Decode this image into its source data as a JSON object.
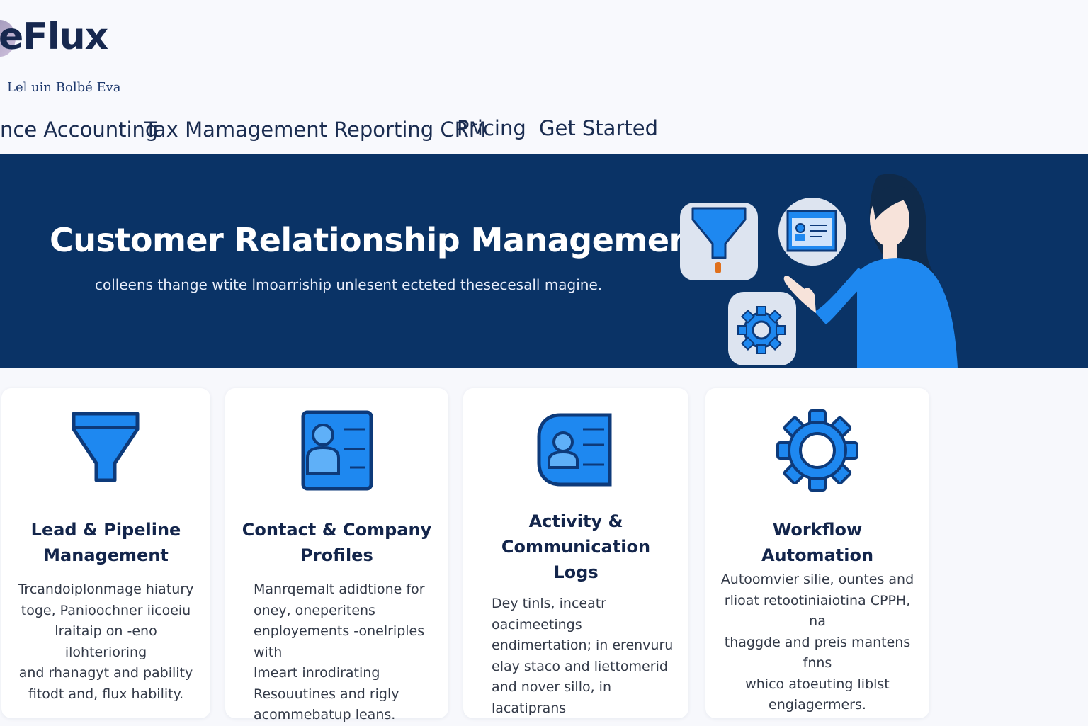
{
  "brand": {
    "logo_text": "eFlux",
    "tagline": "Lel uin Bolbé Eva"
  },
  "nav": {
    "items": [
      {
        "label": "nce Accounting"
      },
      {
        "label": "Tax Mamagement Reporting CRM"
      },
      {
        "label": "Pricing"
      },
      {
        "label": "Get Started"
      }
    ]
  },
  "hero": {
    "title": "Customer Relationship Management",
    "subtitle": "colleens thange wtite lmoarriship unlesent ecteted thesecesall magine."
  },
  "cards": [
    {
      "icon": "funnel-icon",
      "title_lines": [
        "Lead & Pipeline",
        "Management"
      ],
      "body_lines": [
        "Trcandoiplonmage hiatury",
        "toge, Panioochner iicoeiu",
        "lraitaip on -eno ilohterioring",
        "and rhanagyt and pability",
        "fitodt and, flux hability."
      ]
    },
    {
      "icon": "contact-card-icon",
      "title_lines": [
        "Contact & Company",
        "Profiles"
      ],
      "body_lines": [
        "Manrqemalt adidtione for",
        "oney, oneperitens",
        "enployements -onelriples with",
        "lmeart inrodirating",
        "Resouutines and rigly",
        "acommebatup leans."
      ]
    },
    {
      "icon": "activity-log-icon",
      "title_lines": [
        "Activity &",
        "Communication",
        "Logs"
      ],
      "body_lines": [
        "Dey tinls, inceatr oacimeetings",
        "endimertation; in erenvuru",
        "elay staco and liettomerid",
        "and nover sillo, in lacatiprans"
      ]
    },
    {
      "icon": "gear-icon",
      "title_lines": [
        "Workflow Automation"
      ],
      "body_lines": [
        "Autoomvier silie, ountes and",
        "rlioat retootiniaiotina CPPH, na",
        "thaggde and preis mantens fnns",
        "whico atoeuting liblst",
        "engiagermers."
      ]
    }
  ],
  "colors": {
    "hero_bg": "#0a3366",
    "accent_blue": "#1e88f0",
    "icon_outline": "#0d3a7a",
    "heading": "#13254b"
  }
}
